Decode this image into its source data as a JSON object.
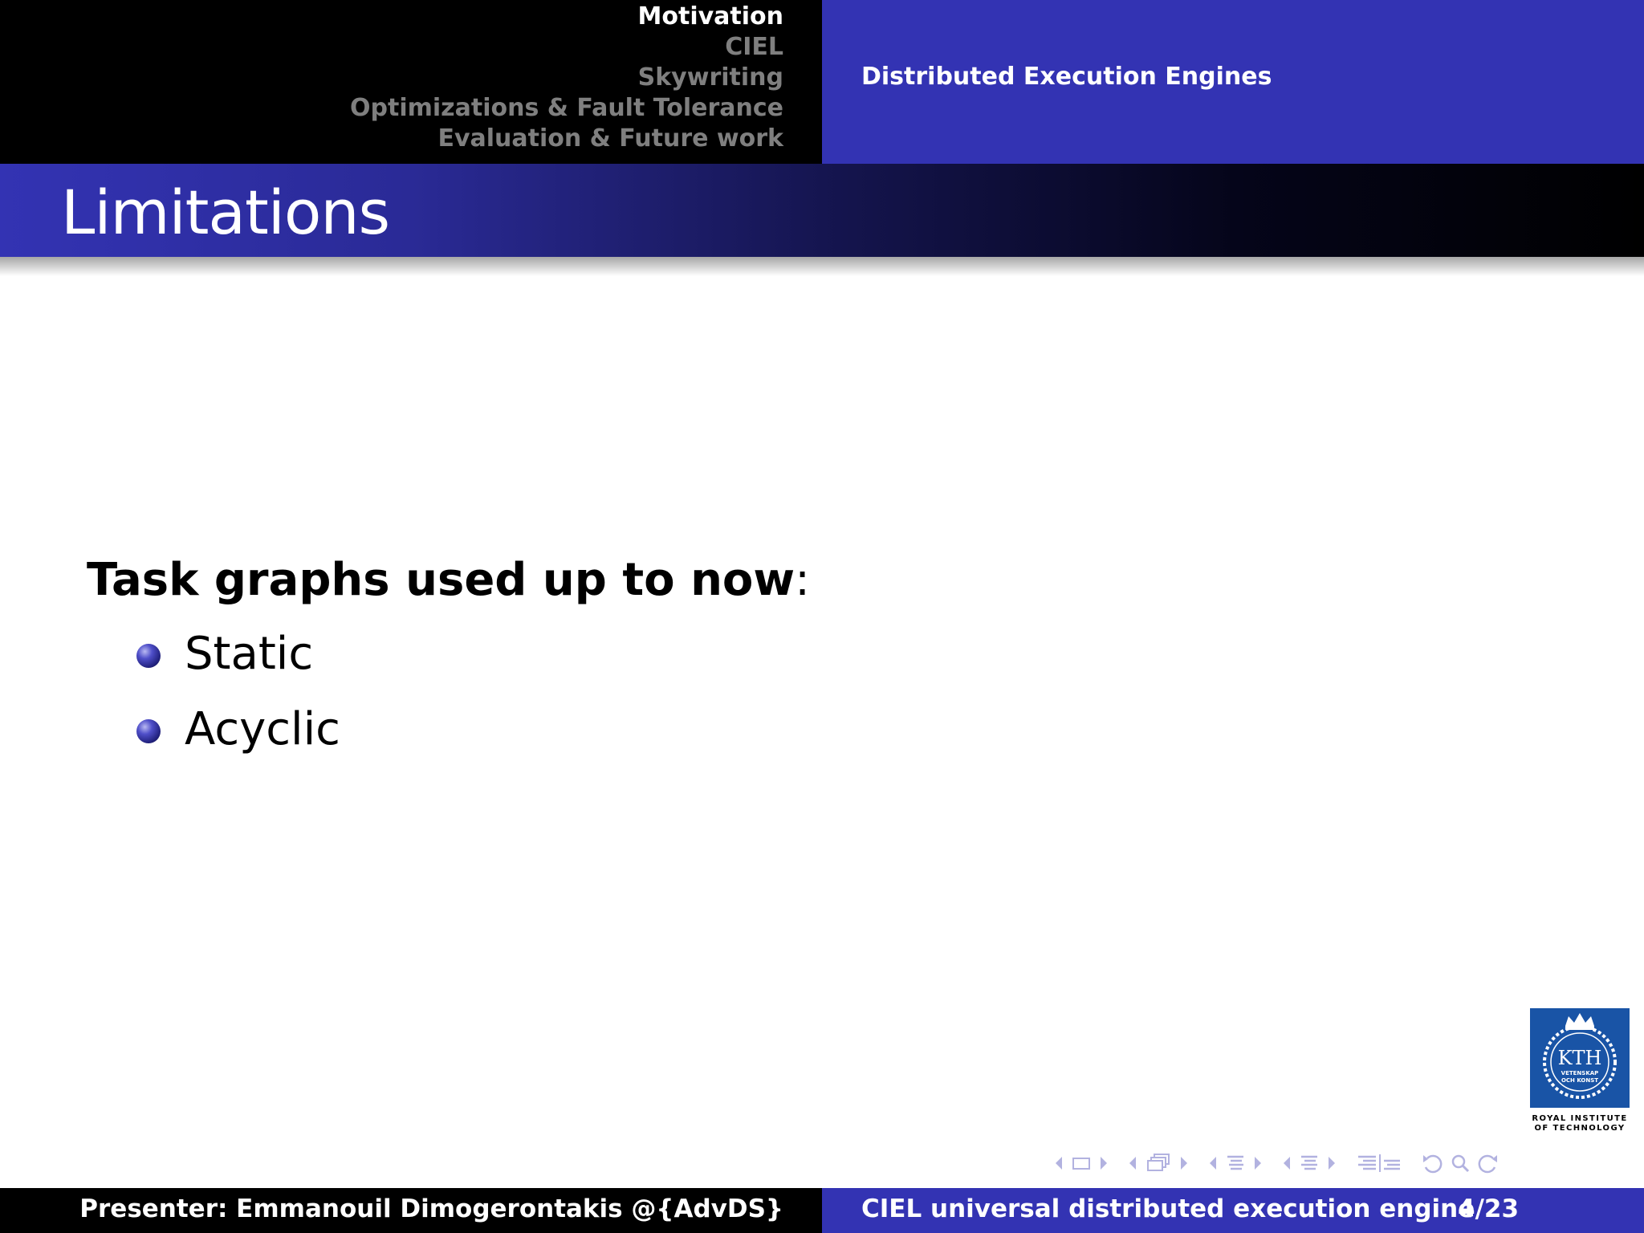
{
  "header": {
    "sections": [
      {
        "label": "Motivation",
        "active": true
      },
      {
        "label": "CIEL",
        "active": false
      },
      {
        "label": "Skywriting",
        "active": false
      },
      {
        "label": "Optimizations & Fault Tolerance",
        "active": false
      },
      {
        "label": "Evaluation & Future work",
        "active": false
      }
    ],
    "subsection": "Distributed Execution Engines"
  },
  "frame": {
    "title": "Limitations",
    "lead_bold": "Task graphs used up to now",
    "lead_tail": ":",
    "bullets": [
      "Static",
      "Acyclic"
    ]
  },
  "logo": {
    "icon": "kth-crest-icon",
    "caption_line1": "ROYAL INSTITUTE",
    "caption_line2": "OF TECHNOLOGY",
    "crest_text": "KTH",
    "crest_sub1": "VETENSKAP",
    "crest_sub2": "OCH KONST"
  },
  "footer": {
    "presenter": "Presenter: Emmanouil Dimogerontakis @{AdvDS}",
    "talk_title": "CIEL universal distributed execution engine",
    "page": "4/23"
  },
  "colors": {
    "beamer_blue": "#3333b3",
    "header_black": "#000000",
    "inactive_section": "#7f7f7f",
    "nav_symbols": "#b2b2e0",
    "kth_blue": "#1954a6"
  }
}
